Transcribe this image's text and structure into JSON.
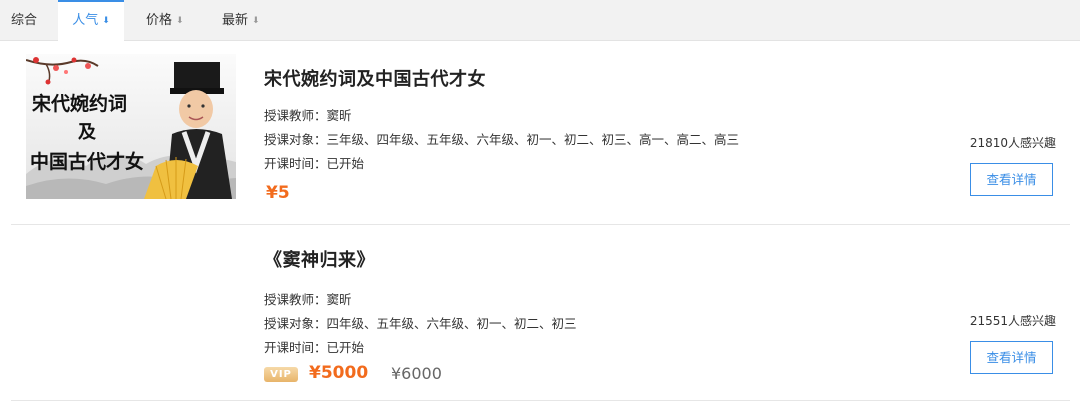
{
  "tabs": [
    {
      "label": "综合",
      "active": false,
      "has_arrow": false
    },
    {
      "label": "人气",
      "active": true,
      "has_arrow": true
    },
    {
      "label": "价格",
      "active": false,
      "has_arrow": true
    },
    {
      "label": "最新",
      "active": false,
      "has_arrow": true
    }
  ],
  "sort_arrow": "⬇",
  "courses": [
    {
      "title": "宋代婉约词及中国古代才女",
      "teacher_label": "授课教师：",
      "teacher": "窦昕",
      "target_label": "授课对象：",
      "target": "三年级、四年级、五年级、六年级、初一、初二、初三、高一、高二、高三",
      "start_label": "开课时间：",
      "start": "已开始",
      "price": "¥5",
      "interest": "21810人感兴趣",
      "button": "查看详情",
      "thumb_text": [
        "宋代婉约词",
        "及",
        "中国古代才女"
      ]
    },
    {
      "title": "《窦神归来》",
      "teacher_label": "授课教师：",
      "teacher": "窦昕",
      "target_label": "授课对象：",
      "target": "四年级、五年级、六年级、初一、初二、初三",
      "start_label": "开课时间：",
      "start": "已开始",
      "vip_badge": "VIP",
      "vip_price": "¥5000",
      "orig_price": "¥6000",
      "interest": "21551人感兴趣",
      "button": "查看详情"
    }
  ],
  "colors": {
    "accent": "#3a8ee6",
    "price": "#f26b1d",
    "tabbar_bg": "#f2f2f2"
  }
}
